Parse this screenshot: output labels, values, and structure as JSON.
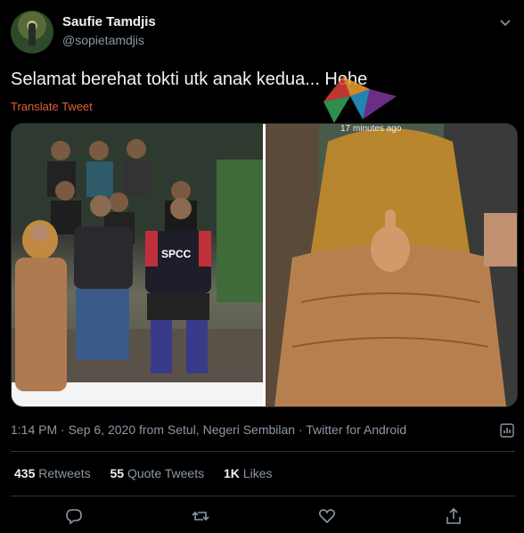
{
  "author": {
    "name": "Saufie Tamdjis",
    "handle": "@sopietamdjis"
  },
  "tweet": {
    "text": "Selamat berehat tokti utk anak kedua... Hehe",
    "translate_label": "Translate Tweet",
    "photo_left_jersey_text": "SPCC",
    "photo_right_overlay_text": "17 minutes ago"
  },
  "meta": {
    "time": "1:14 PM",
    "separator": " · ",
    "date": "Sep 6, 2020",
    "location": "from Setul, Negeri Sembilan",
    "client": "Twitter for Android"
  },
  "stats": {
    "retweets_count": "435",
    "retweets_label": "Retweets",
    "quote_count": "55",
    "quote_label": "Quote Tweets",
    "likes_count": "1K",
    "likes_label": "Likes"
  },
  "icons": {
    "reply": "reply-icon",
    "retweet": "retweet-icon",
    "like": "heart-icon",
    "share": "share-icon",
    "more": "chevron-down-icon",
    "analytics": "analytics-icon"
  },
  "colors": {
    "background": "#000000",
    "text_primary": "#f2f2f2",
    "text_secondary": "#8b98a5",
    "accent_translate": "#e0603a"
  }
}
